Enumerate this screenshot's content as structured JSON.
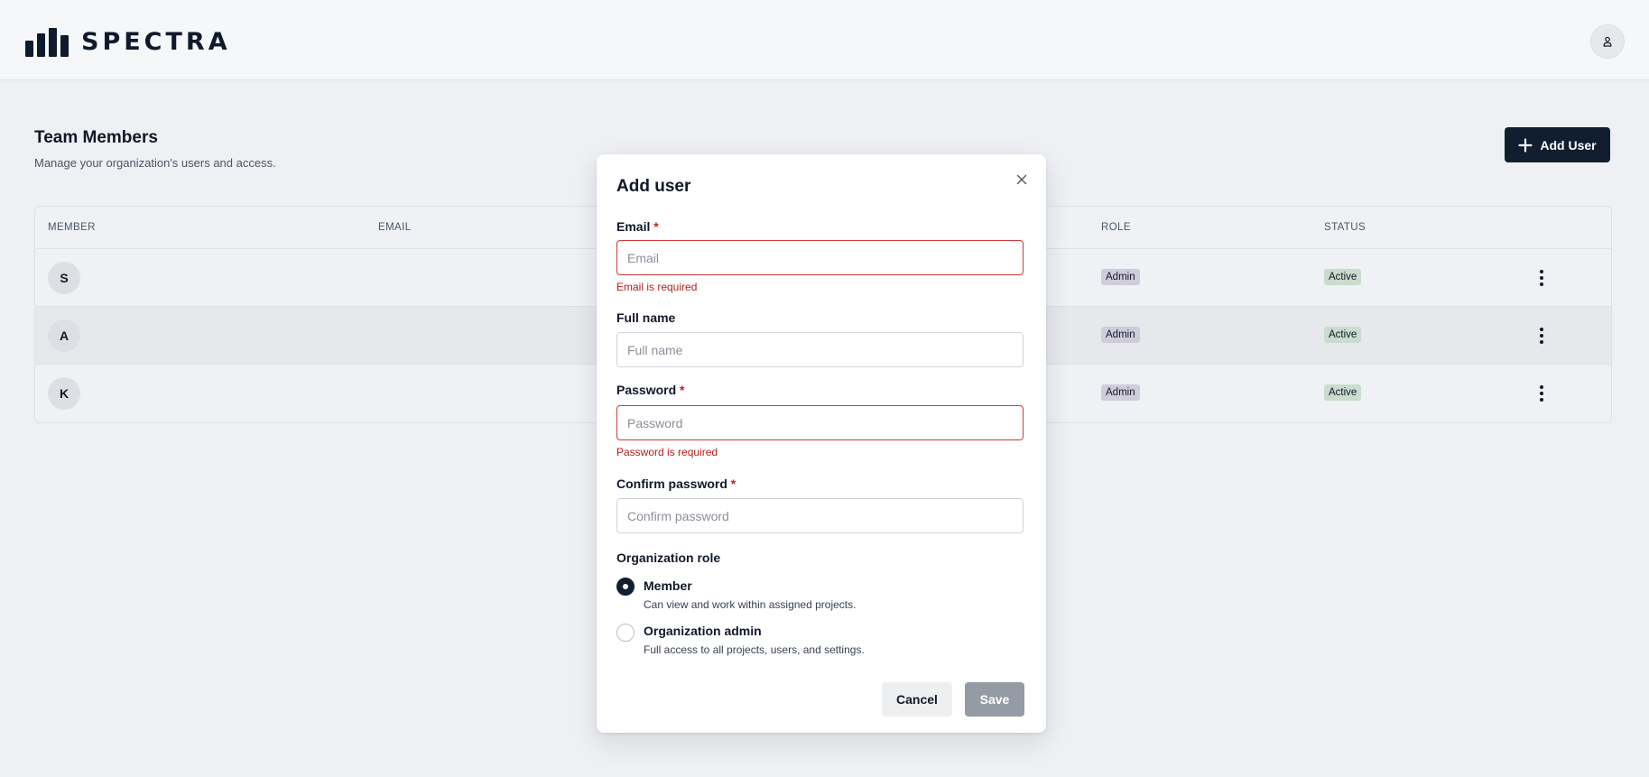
{
  "header": {
    "brand": "SPECTRA",
    "account_icon": "user-icon"
  },
  "page": {
    "title": "Team Members",
    "subtitle": "Manage your organization's users and access.",
    "add_user_label": "Add User",
    "add_icon": "plus-icon"
  },
  "table": {
    "columns": {
      "member": "MEMBER",
      "email": "EMAIL",
      "role": "ROLE",
      "status": "STATUS"
    },
    "rows": [
      {
        "initial": "S",
        "role": "Admin",
        "status": "Active"
      },
      {
        "initial": "A",
        "role": "Admin",
        "status": "Active"
      },
      {
        "initial": "K",
        "role": "Admin",
        "status": "Active"
      }
    ]
  },
  "modal": {
    "title": "Add user",
    "close_icon": "close-icon",
    "email": {
      "label": "Email",
      "required": "*",
      "placeholder": "Email",
      "value": "",
      "error": "Email is required"
    },
    "full_name": {
      "label": "Full name",
      "placeholder": "Full name",
      "value": ""
    },
    "password": {
      "label": "Password",
      "required": "*",
      "placeholder": "Password",
      "value": "",
      "error": "Password is required"
    },
    "confirm_password": {
      "label": "Confirm password",
      "required": "*",
      "placeholder": "Confirm password",
      "value": ""
    },
    "role_section": {
      "label": "Organization role",
      "options": [
        {
          "title": "Member",
          "description": "Can view and work within assigned projects.",
          "selected": true
        },
        {
          "title": "Organization admin",
          "description": "Full access to all projects, users, and settings.",
          "selected": false
        }
      ]
    },
    "cancel_label": "Cancel",
    "save_label": "Save"
  },
  "colors": {
    "brand_dark": "#111e2f",
    "error_red": "#d1393a",
    "role_badge": "#cfccdc",
    "status_badge": "#c9dccd",
    "save_disabled": "#959ba5"
  }
}
